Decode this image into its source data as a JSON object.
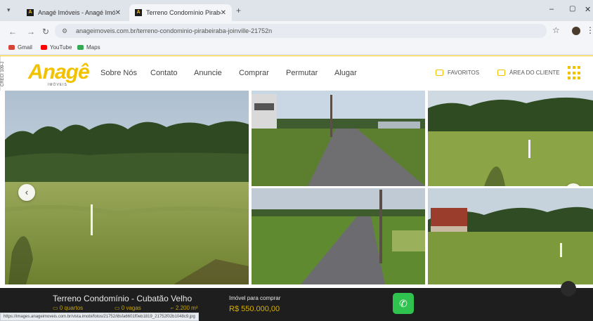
{
  "browser": {
    "tabs": [
      {
        "title": "Anagé Imóveis - Anagé Imóveis",
        "active": false
      },
      {
        "title": "Terreno Condomínio Pirabeiraba",
        "active": true
      }
    ],
    "url": "anageimoveis.com.br/terreno-condominio-pirabeiraba-joinville-21752n",
    "bookmarks": [
      "Gmail",
      "YouTube",
      "Maps"
    ]
  },
  "header": {
    "side_text": "CRECI 109-J",
    "logo": "Anagê",
    "logo_sub": "IMÓVEIS",
    "nav": [
      "Sobre Nós",
      "Contato",
      "Anuncie",
      "Comprar",
      "Permutar",
      "Alugar"
    ],
    "favorites": "FAVORITOS",
    "client_area": "ÁREA DO CLIENTE"
  },
  "listing": {
    "title": "Terreno Condomínio - Cubatão Velho",
    "bedrooms": "0 quartos",
    "parking": "0 vagas",
    "area": "2.200 m²",
    "price_label": "Imóvel para comprar",
    "price": "R$ 550.000,00"
  },
  "status_url": "https://images.anageimoveis.com.br/vista.imobi/fotos/21752/i8sfa6601f0eb1819_21752f02b1048c9.jpg",
  "colors": {
    "brand": "#f2c200",
    "footer_bg": "#1e1e1e",
    "whatsapp": "#2fc24f"
  }
}
